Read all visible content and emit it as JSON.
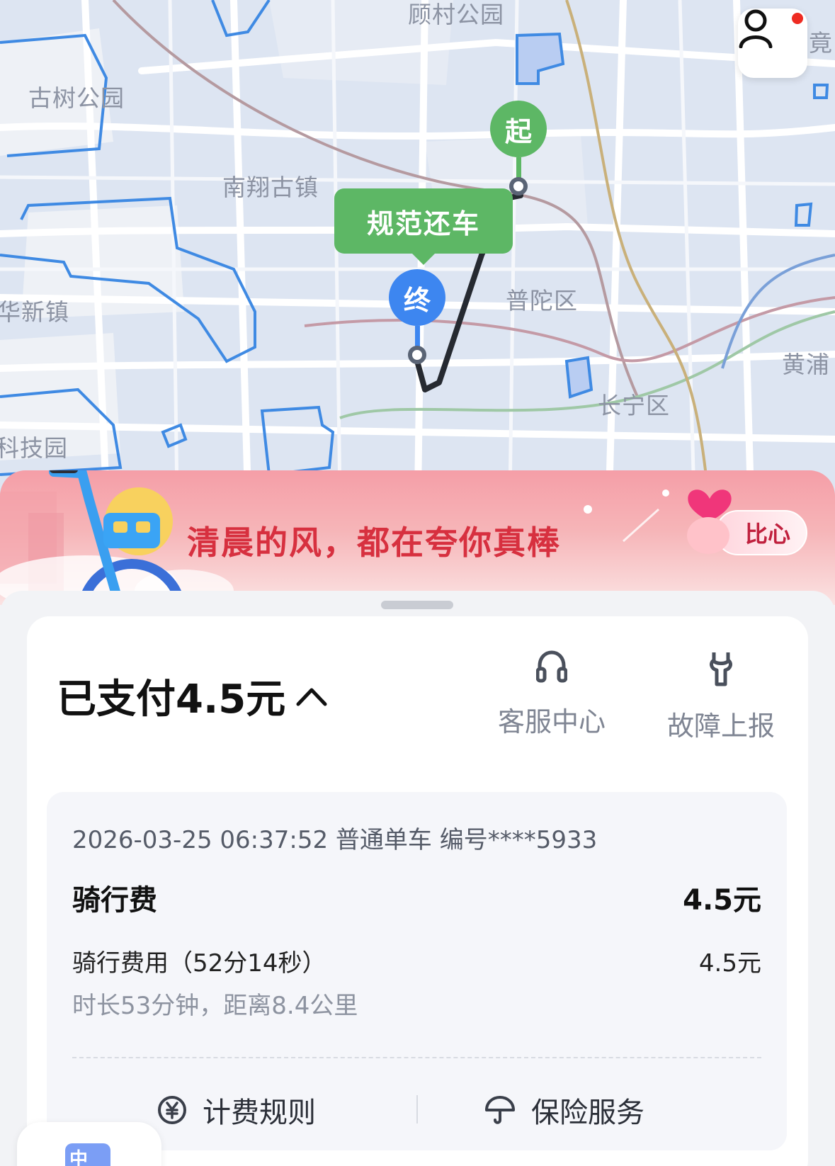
{
  "map": {
    "labels": [
      {
        "key": "gucun",
        "text": "顾村公园"
      },
      {
        "key": "gushu",
        "text": "古树公园"
      },
      {
        "key": "nanxiang",
        "text": "南翔古镇"
      },
      {
        "key": "putuo",
        "text": "普陀区"
      },
      {
        "key": "huaxin",
        "text": "华新镇"
      },
      {
        "key": "huangpu",
        "text": "黄浦"
      },
      {
        "key": "changning",
        "text": "长宁区"
      },
      {
        "key": "keji",
        "text": "科技园"
      },
      {
        "key": "jing",
        "text": "竟"
      }
    ],
    "start_marker": "起",
    "end_marker": "终",
    "return_tag": "规范还车",
    "avatar_icon": "user-icon",
    "colors": {
      "start": "#5db765",
      "end": "#3d86f0",
      "route": "#262a31",
      "district": "#3f8ae3"
    }
  },
  "banner": {
    "text": "清晨的风，都在夸你真棒",
    "button_label": "比心",
    "icons": [
      "bike-icon",
      "heart-hand-icon"
    ]
  },
  "summary": {
    "paid_label": "已支付4.5元",
    "toggle_icon": "chevron-up-icon",
    "actions": [
      {
        "label": "客服中心",
        "icon": "headset-icon"
      },
      {
        "label": "故障上报",
        "icon": "wrench-icon"
      }
    ]
  },
  "trip": {
    "meta": "2026-03-25 06:37:52 普通单车 编号****5933",
    "fee_title": "骑行费",
    "fee_total": "4.5元",
    "fee_item_label": "骑行费用（52分14秒）",
    "fee_item_value": "4.5元",
    "sub_info": "时长53分钟，距离8.4公里",
    "links": [
      {
        "label": "计费规则",
        "icon": "yuan-circle-icon"
      },
      {
        "label": "保险服务",
        "icon": "umbrella-icon"
      }
    ]
  },
  "floater": {
    "text": "中",
    "icon": "app-icon"
  }
}
